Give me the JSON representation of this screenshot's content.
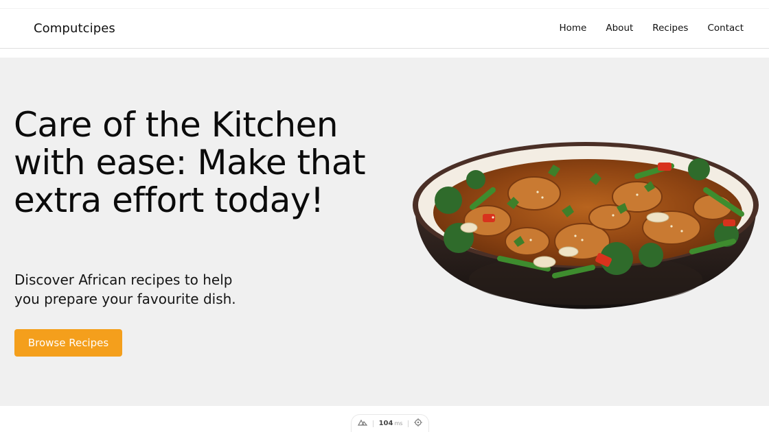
{
  "nav": {
    "brand": "Computcipes",
    "links": [
      "Home",
      "About",
      "Recipes",
      "Contact"
    ]
  },
  "hero": {
    "headline": "Care of the Kitchen with ease: Make that extra effort today!",
    "subtitle": "Discover African recipes to help you prepare your favourite dish.",
    "cta_label": "Browse Recipes",
    "image_subject": "bowl of chicken stir-fry with broccoli, green beans, red peppers and coriander"
  },
  "devbar": {
    "time_value": "104",
    "time_unit": "ms",
    "left_icon": "nuxt-logo-icon",
    "right_icon": "crosshair-icon"
  },
  "colors": {
    "accent": "#f49f1c",
    "hero_bg": "#f0f0f0",
    "text": "#111111"
  }
}
